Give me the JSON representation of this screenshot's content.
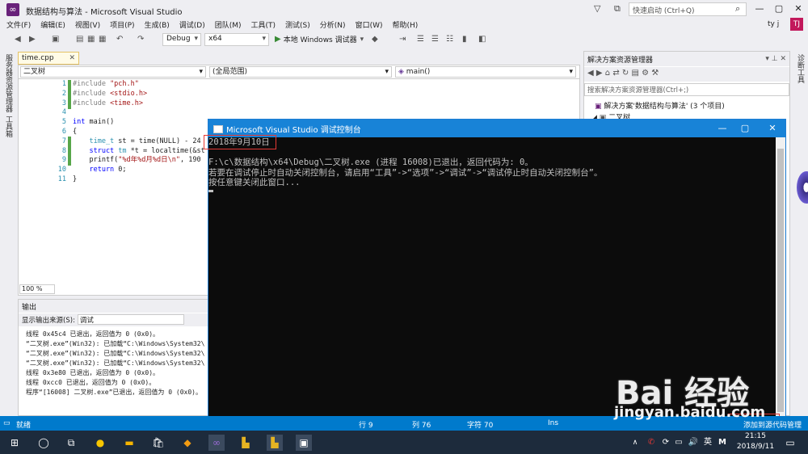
{
  "window": {
    "title": "数据结构与算法 - Microsoft Visual Studio",
    "quick_launch": "快速启动 (Ctrl+Q)"
  },
  "menu": [
    "文件(F)",
    "编辑(E)",
    "视图(V)",
    "项目(P)",
    "生成(B)",
    "调试(D)",
    "团队(M)",
    "工具(T)",
    "测试(S)",
    "分析(N)",
    "窗口(W)",
    "帮助(H)"
  ],
  "user": {
    "name": "ty j",
    "initials": "TJ"
  },
  "toolbar": {
    "config": "Debug",
    "platform": "x64",
    "run_label": "本地 Windows 调试器"
  },
  "left_strip": [
    "服务器资源管理器",
    "工具箱"
  ],
  "editor": {
    "tab": "time.cpp",
    "nav_left": "二叉树",
    "nav_mid": "(全局范围)",
    "nav_right": "main()",
    "line_numbers": [
      "1",
      "2",
      "3",
      "4",
      "5",
      "6",
      "7",
      "8",
      "9",
      "10",
      "11"
    ],
    "lines": [
      {
        "parts": [
          {
            "t": "#include ",
            "c": "pp"
          },
          {
            "t": "\"pch.h\"",
            "c": "str"
          }
        ]
      },
      {
        "parts": [
          {
            "t": "#include ",
            "c": "pp"
          },
          {
            "t": "<stdio.h>",
            "c": "str"
          }
        ]
      },
      {
        "parts": [
          {
            "t": "#include ",
            "c": "pp"
          },
          {
            "t": "<time.h>",
            "c": "str"
          }
        ]
      },
      {
        "parts": []
      },
      {
        "parts": [
          {
            "t": "int ",
            "c": "kw"
          },
          {
            "t": "main()",
            "c": ""
          }
        ]
      },
      {
        "parts": [
          {
            "t": "{",
            "c": ""
          }
        ]
      },
      {
        "parts": [
          {
            "t": "    time_t ",
            "c": "ty"
          },
          {
            "t": "st = time(NULL) - 24",
            "c": ""
          }
        ]
      },
      {
        "parts": [
          {
            "t": "    struct ",
            "c": "kw"
          },
          {
            "t": "tm ",
            "c": "ty"
          },
          {
            "t": "*t = localtime(&st",
            "c": ""
          }
        ]
      },
      {
        "parts": [
          {
            "t": "    printf(",
            "c": ""
          },
          {
            "t": "\"%d年%d月%d日\\n\"",
            "c": "str"
          },
          {
            "t": ", 190",
            "c": ""
          }
        ]
      },
      {
        "parts": [
          {
            "t": "    return ",
            "c": "kw"
          },
          {
            "t": "0;",
            "c": ""
          }
        ]
      },
      {
        "parts": [
          {
            "t": "}",
            "c": ""
          }
        ]
      }
    ],
    "zoom": "100 %"
  },
  "output": {
    "title": "输出",
    "source_label": "显示输出来源(S):",
    "source_value": "调试",
    "lines": [
      "线程 0x45c4 已退出，返回值为 0 (0x0)。",
      "“二叉树.exe”(Win32): 已加载“C:\\Windows\\System32\\",
      "“二叉树.exe”(Win32): 已加载“C:\\Windows\\System32\\",
      "“二叉树.exe”(Win32): 已加载“C:\\Windows\\System32\\",
      "线程 0x3e80 已退出，返回值为 0 (0x0)。",
      "线程 0xcc0 已退出，返回值为 0 (0x0)。",
      "程序“[16008] 二叉树.exe”已退出，返回值为 0 (0x0)。"
    ]
  },
  "solution_explorer": {
    "title": "解决方案资源管理器",
    "search": "搜索解决方案资源管理器(Ctrl+;)",
    "solution": "解决方案'数据结构与算法' (3 个项目)",
    "project": "二叉树"
  },
  "right_strip": [
    "诊断工具"
  ],
  "console": {
    "title": "Microsoft Visual Studio 调试控制台",
    "lines": [
      "2018年9月10日",
      "",
      "F:\\c\\数据结构\\x64\\Debug\\二叉树.exe (进程 16008)已退出，返回代码为: 0。",
      "若要在调试停止时自动关闭控制台，请启用“工具”->“选项”->“调试”->“调试停止时自动关闭控制台”。",
      "按任意键关闭此窗口..."
    ]
  },
  "status": {
    "ready": "就绪",
    "row": "行 9",
    "col": "列 76",
    "char": "字符 70",
    "mode": "Ins",
    "right": "添加到源代码管理"
  },
  "taskbar": {
    "time": "21:15",
    "date": "2018/9/11",
    "ime": "英",
    "ime2": "M"
  },
  "watermark": {
    "brand": "Bai 经验",
    "url": "jingyan.baidu.com"
  },
  "colors": {
    "accent": "#007acc",
    "console_title": "#1883d7",
    "vs_purple": "#68217a",
    "annotation": "#e53935"
  }
}
